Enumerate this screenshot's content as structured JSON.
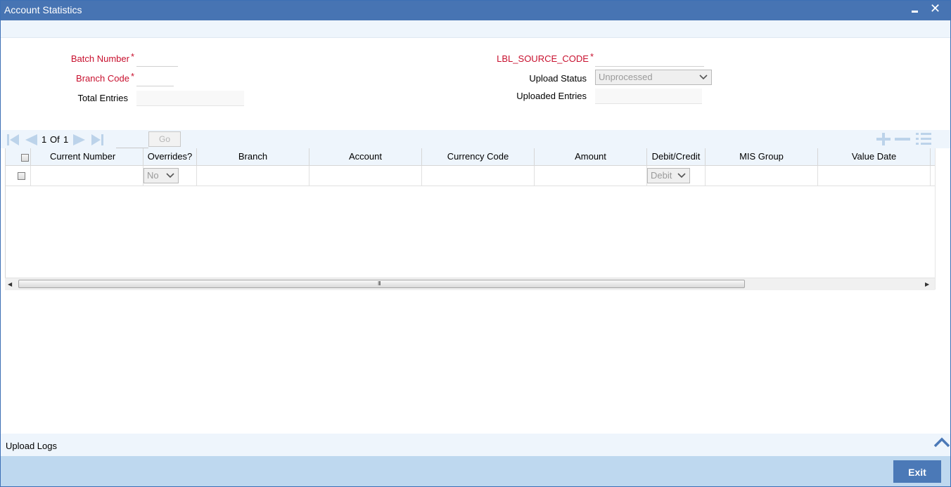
{
  "window": {
    "title": "Account Statistics",
    "close_glyph": "✕"
  },
  "form": {
    "batch_number": {
      "label": "Batch Number",
      "value": ""
    },
    "branch_code": {
      "label": "Branch Code",
      "value": ""
    },
    "total_entries": {
      "label": "Total Entries",
      "value": ""
    },
    "source_code": {
      "label": "LBL_SOURCE_CODE",
      "value": ""
    },
    "upload_status": {
      "label": "Upload Status",
      "selected": "Unprocessed"
    },
    "uploaded_entries": {
      "label": "Uploaded Entries",
      "value": ""
    },
    "required_mark": "*"
  },
  "pager": {
    "current": "1",
    "of_label": "Of",
    "total": "1",
    "go_label": "Go"
  },
  "grid": {
    "columns": [
      "Current Number",
      "Overrides?",
      "Branch",
      "Account",
      "Currency Code",
      "Amount",
      "Debit/Credit",
      "MIS Group",
      "Value Date"
    ],
    "rows": [
      {
        "overrides": "No",
        "debit_credit": "Debit"
      }
    ]
  },
  "scrollbar": {
    "grip": "III"
  },
  "footer": {
    "upload_logs": "Upload Logs",
    "exit_label": "Exit"
  },
  "colors": {
    "titlebar": "#4774b3",
    "accent_light": "#eef5fc",
    "footer": "#bed8ef",
    "required": "#c8102e",
    "exit_button": "#4b79b7"
  },
  "icons": [
    "minimize-icon",
    "close-icon",
    "first-page-icon",
    "previous-page-icon",
    "next-page-icon",
    "last-page-icon",
    "add-row-icon",
    "delete-row-icon",
    "single-view-icon",
    "chevron-down-icon",
    "chevron-up-icon"
  ]
}
